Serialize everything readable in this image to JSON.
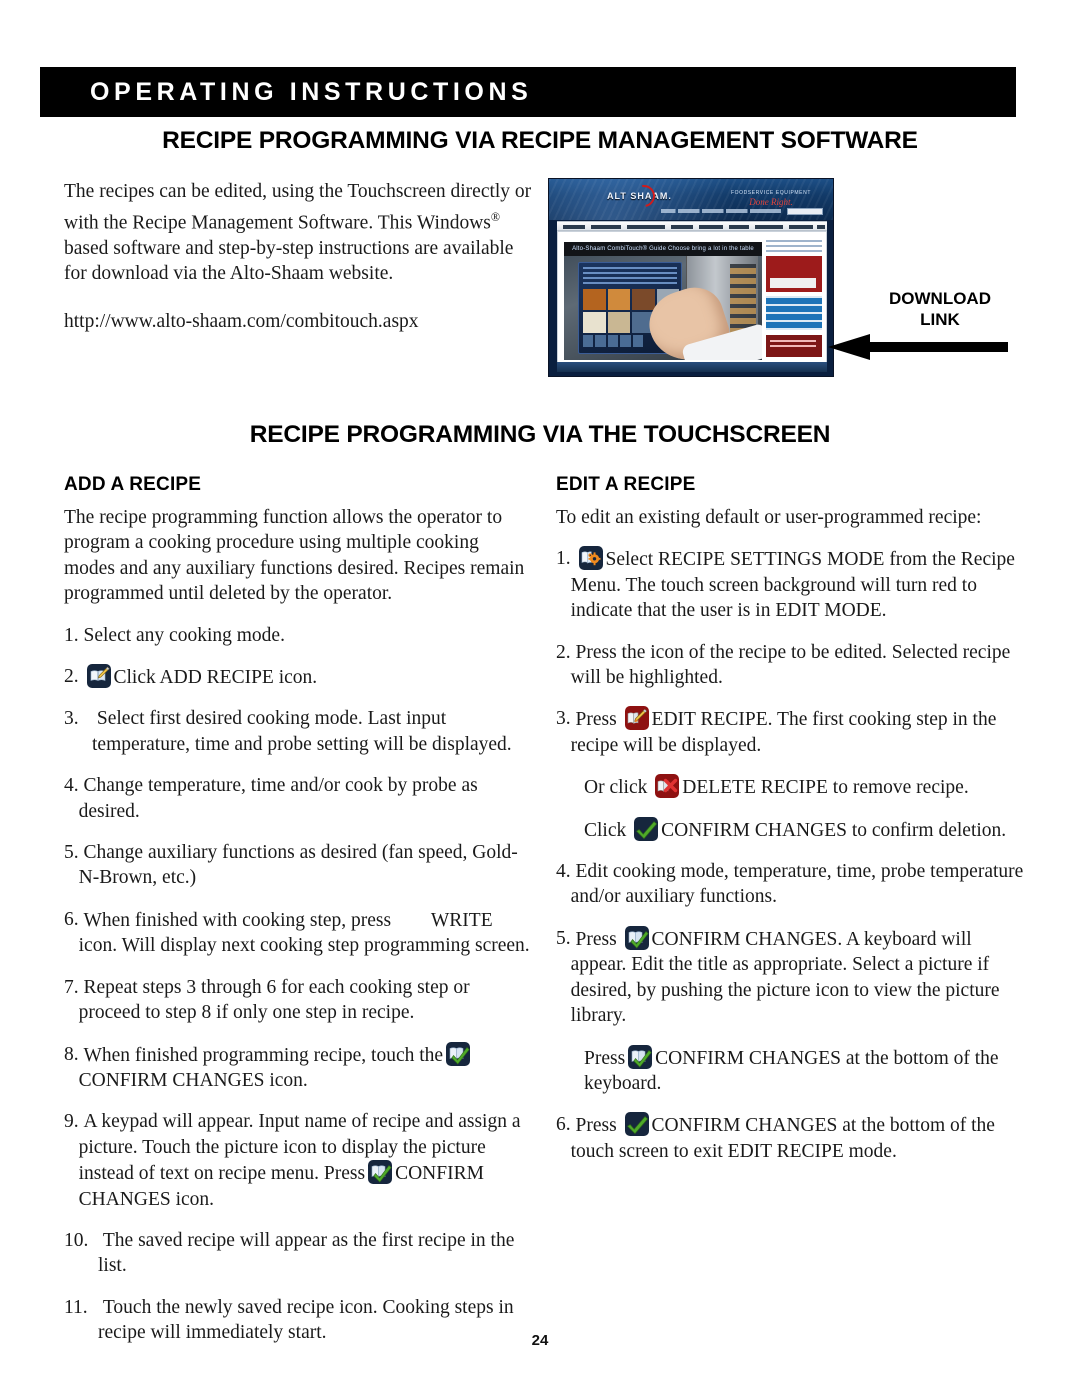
{
  "banner": {
    "title": "OPERATING INSTRUCTIONS"
  },
  "headings": {
    "software": "RECIPE PROGRAMMING VIA RECIPE MANAGEMENT SOFTWARE",
    "touchscreen": "RECIPE PROGRAMMING VIA THE TOUCHSCREEN",
    "add_recipe": "ADD A RECIPE",
    "edit_recipe": "EDIT A RECIPE"
  },
  "intro": {
    "paragraph_part1": "The recipes can be edited, using the Touchscreen directly or with the Recipe Management Software.  This Windows",
    "registered_mark": "®",
    "paragraph_part2": " based software and step-by-step instructions are available for download via the Alto-Shaam website.",
    "url": "http://www.alto-shaam.com/combitouch.aspx"
  },
  "site_screenshot": {
    "logo": "ALT    SHAAM.",
    "tagline_line1": "FOODSERVICE EQUIPMENT",
    "tagline_line2": "Done Right.",
    "hero_title": "Alto-Shaam CombiTouch® Guide Choose bring a lot in the table"
  },
  "download_callout": {
    "line1": "DOWNLOAD",
    "line2": "LINK"
  },
  "add_recipe": {
    "intro": "The recipe programming function allows the operator to program a cooking procedure using multiple cooking modes and any auxiliary functions desired. Recipes remain programmed until deleted by the operator.",
    "steps": [
      {
        "num": "1.",
        "text": "Select any cooking mode."
      },
      {
        "num": "2.",
        "icon": "add-recipe-icon",
        "text": "Click ADD RECIPE icon."
      },
      {
        "num": "3.",
        "text": "Select first desired cooking mode. Last input temperature, time and probe setting will be displayed."
      },
      {
        "num": "4.",
        "text": "Change temperature, time and/or cook by probe as desired."
      },
      {
        "num": "5.",
        "text": "Change auxiliary functions as desired (fan speed, Gold-N-Brown, etc.)"
      },
      {
        "num": "6.",
        "text_before": "When finished with cooking step, press",
        "text_after": "WRITE icon. Will display next cooking step programming screen."
      },
      {
        "num": "7.",
        "text": "Repeat steps 3 through 6 for each cooking step or proceed to step 8 if only one step in recipe."
      },
      {
        "num": "8.",
        "text_before": "When finished programming recipe, touch the",
        "icon": "confirm-changes-icon",
        "text_after": "CONFIRM CHANGES icon."
      },
      {
        "num": "9.",
        "text_before": "A keypad will appear. Input name of recipe and assign a picture. Touch the picture icon to display the picture instead of text on recipe menu. Press",
        "icon": "confirm-changes-icon",
        "text_after": "CONFIRM CHANGES icon."
      },
      {
        "num": "10.",
        "text": "The saved recipe will appear as the first recipe in the list."
      },
      {
        "num": "11.",
        "text": "Touch the newly saved recipe icon. Cooking steps in recipe will immediately start."
      }
    ]
  },
  "edit_recipe": {
    "intro": "To edit an existing default or user-programmed recipe:",
    "steps": [
      {
        "num": "1.",
        "icon": "recipe-settings-mode-icon",
        "text": "Select RECIPE SETTINGS MODE from the Recipe Menu. The touch screen background will turn red to indicate that the user is in EDIT MODE."
      },
      {
        "num": "2.",
        "text": "Press the icon of the recipe to be edited. Selected recipe will be highlighted."
      },
      {
        "num": "3.",
        "text_before": "Press",
        "icon": "edit-recipe-icon",
        "text_after": "EDIT RECIPE. The first cooking step in the recipe will be displayed."
      },
      {
        "num": "",
        "text_before": "Or click",
        "icon": "delete-recipe-icon",
        "text_after": "DELETE RECIPE to remove recipe."
      },
      {
        "num": "",
        "text_before": "Click",
        "icon": "confirm-check-icon",
        "text_after": "CONFIRM CHANGES to confirm deletion."
      },
      {
        "num": "4.",
        "text": "Edit cooking mode, temperature, time, probe temperature and/or auxiliary functions."
      },
      {
        "num": "5.",
        "text_before": "Press",
        "icon": "confirm-changes-icon",
        "text_after": "CONFIRM CHANGES. A keyboard will appear. Edit the title as appropriate. Select a picture if desired, by pushing the picture icon to view the picture library."
      },
      {
        "num": "",
        "text_before": "Press",
        "icon": "confirm-changes-icon",
        "text_after": "CONFIRM CHANGES at the bottom of the keyboard."
      },
      {
        "num": "6.",
        "text_before": "Press",
        "icon": "confirm-check-icon",
        "text_after": "CONFIRM CHANGES at the bottom of the touch screen to exit EDIT RECIPE mode."
      }
    ]
  },
  "page_number": "24",
  "colors": {
    "banner_bg": "#000000",
    "icon_navy": "#16263d",
    "icon_dark_red": "#8e1111",
    "check_green": "#4faa2a",
    "gear_orange": "#f08a1e"
  }
}
